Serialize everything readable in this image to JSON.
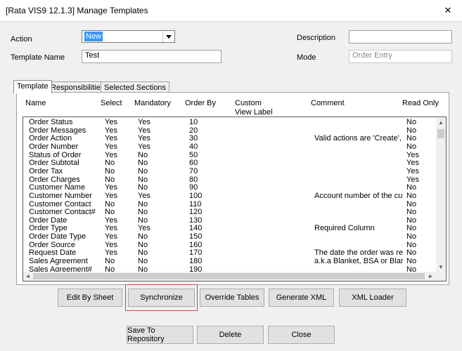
{
  "window": {
    "title": "[Rata VIS9 12.1.3] Manage Templates",
    "close_glyph": "✕"
  },
  "form": {
    "action_label": "Action",
    "action_value": "New",
    "template_name_label": "Template Name",
    "template_name_value": "Test",
    "description_label": "Description",
    "description_value": "",
    "mode_label": "Mode",
    "mode_value": "Order Entry"
  },
  "tabs": [
    {
      "label": "Template",
      "active": true
    },
    {
      "label": "Responsibilities",
      "active": false
    },
    {
      "label": "Selected Sections",
      "active": false
    }
  ],
  "grid": {
    "headers": {
      "name": "Name",
      "select": "Select",
      "mandatory": "Mandatory",
      "order_by": "Order By",
      "custom_view_label_1": "Custom",
      "custom_view_label_2": "View Label",
      "comment": "Comment",
      "read_only": "Read Only"
    },
    "rows": [
      {
        "name": "Order Status",
        "select": "Yes",
        "mandatory": "Yes",
        "order_by": "10",
        "comment": "",
        "read_only": "No"
      },
      {
        "name": "Order Messages",
        "select": "Yes",
        "mandatory": "Yes",
        "order_by": "20",
        "comment": "",
        "read_only": "No"
      },
      {
        "name": "Order Action",
        "select": "Yes",
        "mandatory": "Yes",
        "order_by": "30",
        "comment": "Valid actions are 'Create', 'Cr",
        "read_only": "No"
      },
      {
        "name": "Order Number",
        "select": "Yes",
        "mandatory": "Yes",
        "order_by": "40",
        "comment": "",
        "read_only": "No"
      },
      {
        "name": "Status of Order",
        "select": "Yes",
        "mandatory": "No",
        "order_by": "50",
        "comment": "",
        "read_only": "Yes"
      },
      {
        "name": "Order Subtotal",
        "select": "No",
        "mandatory": "No",
        "order_by": "60",
        "comment": "",
        "read_only": "Yes"
      },
      {
        "name": "Order Tax",
        "select": "No",
        "mandatory": "No",
        "order_by": "70",
        "comment": "",
        "read_only": "Yes"
      },
      {
        "name": "Order Charges",
        "select": "No",
        "mandatory": "No",
        "order_by": "80",
        "comment": "",
        "read_only": "Yes"
      },
      {
        "name": "Customer Name",
        "select": "Yes",
        "mandatory": "No",
        "order_by": "90",
        "comment": "",
        "read_only": "No"
      },
      {
        "name": "Customer Number",
        "select": "Yes",
        "mandatory": "Yes",
        "order_by": "100",
        "comment": "Account number of the custo",
        "read_only": "No"
      },
      {
        "name": "Customer Contact",
        "select": "No",
        "mandatory": "No",
        "order_by": "110",
        "comment": "",
        "read_only": "No"
      },
      {
        "name": "Customer Contact#",
        "select": "No",
        "mandatory": "No",
        "order_by": "120",
        "comment": "",
        "read_only": "No"
      },
      {
        "name": "Order Date",
        "select": "Yes",
        "mandatory": "No",
        "order_by": "130",
        "comment": "",
        "read_only": "No"
      },
      {
        "name": "Order Type",
        "select": "Yes",
        "mandatory": "Yes",
        "order_by": "140",
        "comment": "Required Column",
        "read_only": "No"
      },
      {
        "name": "Order Date Type",
        "select": "Yes",
        "mandatory": "No",
        "order_by": "150",
        "comment": "",
        "read_only": "No"
      },
      {
        "name": "Order Source",
        "select": "Yes",
        "mandatory": "No",
        "order_by": "160",
        "comment": "",
        "read_only": "No"
      },
      {
        "name": "Request Date",
        "select": "Yes",
        "mandatory": "No",
        "order_by": "170",
        "comment": "The date the order was requ",
        "read_only": "No"
      },
      {
        "name": "Sales Agreement",
        "select": "No",
        "mandatory": "No",
        "order_by": "180",
        "comment": "a.k.a Blanket, BSA or Blanke",
        "read_only": "No"
      },
      {
        "name": "Sales Agreement#",
        "select": "No",
        "mandatory": "No",
        "order_by": "190",
        "comment": "",
        "read_only": "No"
      }
    ]
  },
  "scroll_glyphs": {
    "up": "▲",
    "down": "▼",
    "left": "◄",
    "right": "►"
  },
  "buttons": {
    "edit_by_sheet": "Edit By Sheet",
    "synchronize": "Synchronize",
    "override_tables": "Override Tables",
    "generate_xml": "Generate XML",
    "xml_loader": "XML Loader",
    "save_to_repository": "Save To Repository",
    "delete": "Delete",
    "close": "Close"
  },
  "colors": {
    "selection": "#3399ff",
    "highlight_border": "#e04040",
    "button_face": "#e1e1e1",
    "dialog_bg": "#f0f0f0"
  }
}
